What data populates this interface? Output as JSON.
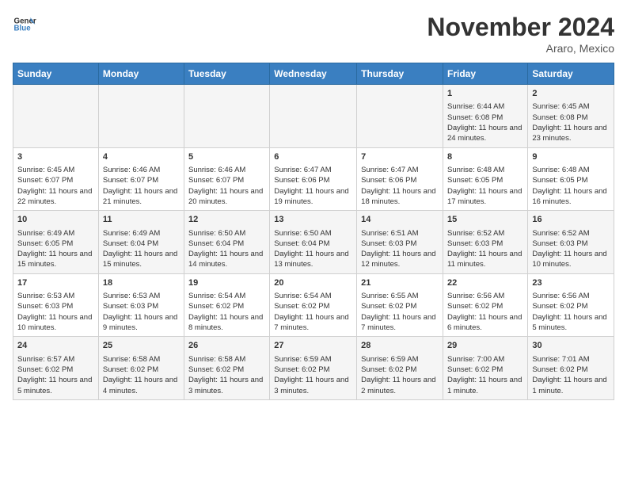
{
  "header": {
    "logo_line1": "General",
    "logo_line2": "Blue",
    "month": "November 2024",
    "location": "Araro, Mexico"
  },
  "weekdays": [
    "Sunday",
    "Monday",
    "Tuesday",
    "Wednesday",
    "Thursday",
    "Friday",
    "Saturday"
  ],
  "weeks": [
    [
      {
        "day": "",
        "info": ""
      },
      {
        "day": "",
        "info": ""
      },
      {
        "day": "",
        "info": ""
      },
      {
        "day": "",
        "info": ""
      },
      {
        "day": "",
        "info": ""
      },
      {
        "day": "1",
        "info": "Sunrise: 6:44 AM\nSunset: 6:08 PM\nDaylight: 11 hours and 24 minutes."
      },
      {
        "day": "2",
        "info": "Sunrise: 6:45 AM\nSunset: 6:08 PM\nDaylight: 11 hours and 23 minutes."
      }
    ],
    [
      {
        "day": "3",
        "info": "Sunrise: 6:45 AM\nSunset: 6:07 PM\nDaylight: 11 hours and 22 minutes."
      },
      {
        "day": "4",
        "info": "Sunrise: 6:46 AM\nSunset: 6:07 PM\nDaylight: 11 hours and 21 minutes."
      },
      {
        "day": "5",
        "info": "Sunrise: 6:46 AM\nSunset: 6:07 PM\nDaylight: 11 hours and 20 minutes."
      },
      {
        "day": "6",
        "info": "Sunrise: 6:47 AM\nSunset: 6:06 PM\nDaylight: 11 hours and 19 minutes."
      },
      {
        "day": "7",
        "info": "Sunrise: 6:47 AM\nSunset: 6:06 PM\nDaylight: 11 hours and 18 minutes."
      },
      {
        "day": "8",
        "info": "Sunrise: 6:48 AM\nSunset: 6:05 PM\nDaylight: 11 hours and 17 minutes."
      },
      {
        "day": "9",
        "info": "Sunrise: 6:48 AM\nSunset: 6:05 PM\nDaylight: 11 hours and 16 minutes."
      }
    ],
    [
      {
        "day": "10",
        "info": "Sunrise: 6:49 AM\nSunset: 6:05 PM\nDaylight: 11 hours and 15 minutes."
      },
      {
        "day": "11",
        "info": "Sunrise: 6:49 AM\nSunset: 6:04 PM\nDaylight: 11 hours and 15 minutes."
      },
      {
        "day": "12",
        "info": "Sunrise: 6:50 AM\nSunset: 6:04 PM\nDaylight: 11 hours and 14 minutes."
      },
      {
        "day": "13",
        "info": "Sunrise: 6:50 AM\nSunset: 6:04 PM\nDaylight: 11 hours and 13 minutes."
      },
      {
        "day": "14",
        "info": "Sunrise: 6:51 AM\nSunset: 6:03 PM\nDaylight: 11 hours and 12 minutes."
      },
      {
        "day": "15",
        "info": "Sunrise: 6:52 AM\nSunset: 6:03 PM\nDaylight: 11 hours and 11 minutes."
      },
      {
        "day": "16",
        "info": "Sunrise: 6:52 AM\nSunset: 6:03 PM\nDaylight: 11 hours and 10 minutes."
      }
    ],
    [
      {
        "day": "17",
        "info": "Sunrise: 6:53 AM\nSunset: 6:03 PM\nDaylight: 11 hours and 10 minutes."
      },
      {
        "day": "18",
        "info": "Sunrise: 6:53 AM\nSunset: 6:03 PM\nDaylight: 11 hours and 9 minutes."
      },
      {
        "day": "19",
        "info": "Sunrise: 6:54 AM\nSunset: 6:02 PM\nDaylight: 11 hours and 8 minutes."
      },
      {
        "day": "20",
        "info": "Sunrise: 6:54 AM\nSunset: 6:02 PM\nDaylight: 11 hours and 7 minutes."
      },
      {
        "day": "21",
        "info": "Sunrise: 6:55 AM\nSunset: 6:02 PM\nDaylight: 11 hours and 7 minutes."
      },
      {
        "day": "22",
        "info": "Sunrise: 6:56 AM\nSunset: 6:02 PM\nDaylight: 11 hours and 6 minutes."
      },
      {
        "day": "23",
        "info": "Sunrise: 6:56 AM\nSunset: 6:02 PM\nDaylight: 11 hours and 5 minutes."
      }
    ],
    [
      {
        "day": "24",
        "info": "Sunrise: 6:57 AM\nSunset: 6:02 PM\nDaylight: 11 hours and 5 minutes."
      },
      {
        "day": "25",
        "info": "Sunrise: 6:58 AM\nSunset: 6:02 PM\nDaylight: 11 hours and 4 minutes."
      },
      {
        "day": "26",
        "info": "Sunrise: 6:58 AM\nSunset: 6:02 PM\nDaylight: 11 hours and 3 minutes."
      },
      {
        "day": "27",
        "info": "Sunrise: 6:59 AM\nSunset: 6:02 PM\nDaylight: 11 hours and 3 minutes."
      },
      {
        "day": "28",
        "info": "Sunrise: 6:59 AM\nSunset: 6:02 PM\nDaylight: 11 hours and 2 minutes."
      },
      {
        "day": "29",
        "info": "Sunrise: 7:00 AM\nSunset: 6:02 PM\nDaylight: 11 hours and 1 minute."
      },
      {
        "day": "30",
        "info": "Sunrise: 7:01 AM\nSunset: 6:02 PM\nDaylight: 11 hours and 1 minute."
      }
    ]
  ]
}
